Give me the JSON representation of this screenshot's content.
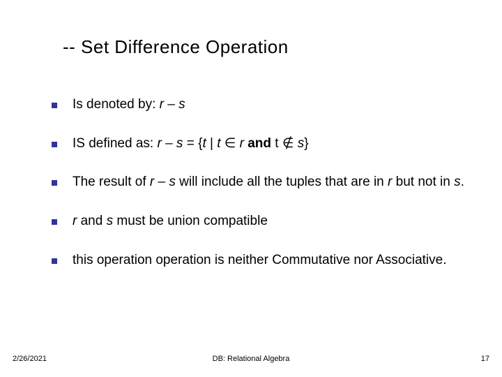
{
  "title": "-- Set Difference Operation",
  "bullets": {
    "b1": {
      "pre": "Is denoted by:  ",
      "expr": "r – s"
    },
    "b2": {
      "pre": "IS defined as: ",
      "expr1": " r – s ",
      "eq": " = {",
      "t1": "t ",
      "bar": "| ",
      "t2": "t ",
      "in": "∈",
      "r": " r ",
      "and": "and",
      "tsp": " t ",
      "notin": "∉",
      "ssp": " s",
      "close": "}"
    },
    "b3": {
      "p1": "The result of ",
      "rs": "r – s ",
      "p2": "will include all the tuples that are in ",
      "r2": "r ",
      "p3": "but not in ",
      "s2": "s",
      "dot": "."
    },
    "b4": {
      "r": "r ",
      "p1": " and ",
      "s": "s",
      "p2": " must be union compatible"
    },
    "b5": "  this operation operation is neither Commutative nor Associative."
  },
  "footer": {
    "date": "2/26/2021",
    "mid": "DB: Relational Algebra",
    "num": "17"
  }
}
